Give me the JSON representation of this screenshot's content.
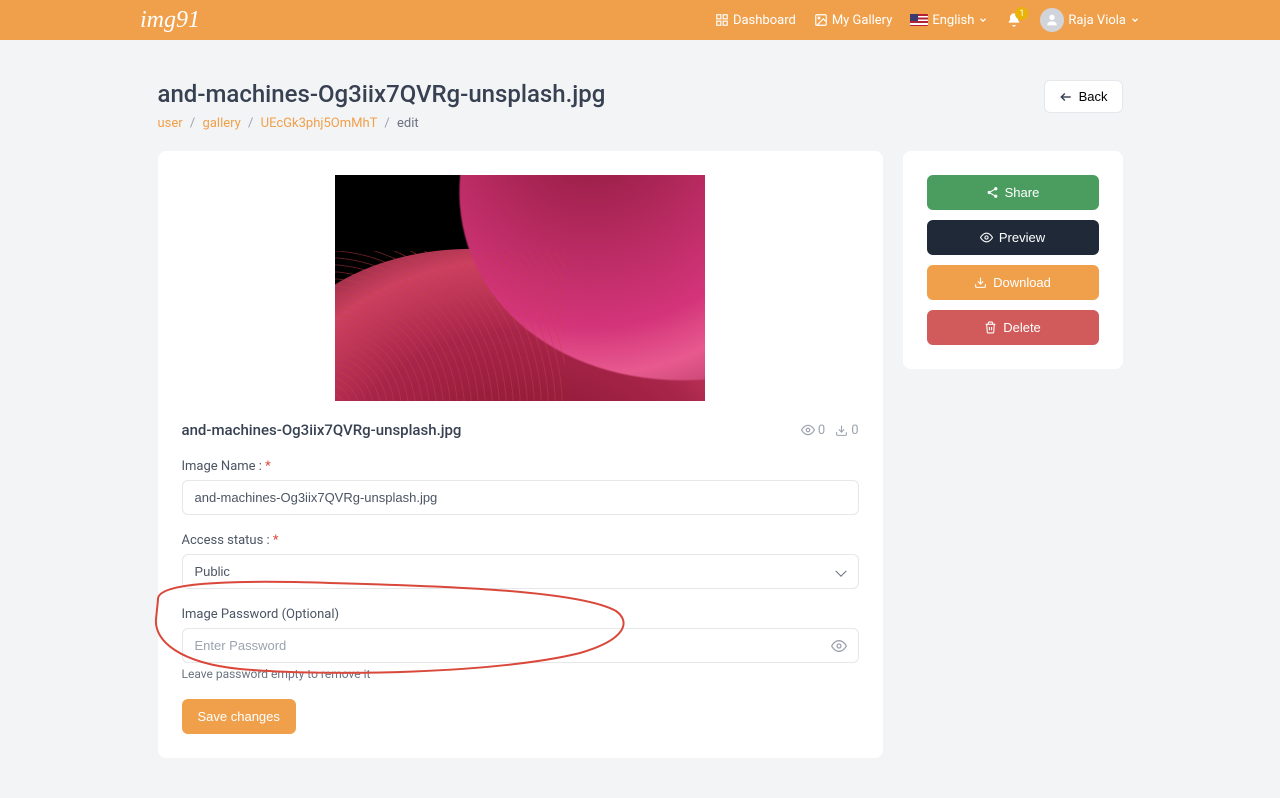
{
  "brand": "img91",
  "nav": {
    "dashboard": "Dashboard",
    "gallery": "My Gallery",
    "language": "English",
    "user": "Raja Viola",
    "notif_count": "1"
  },
  "page": {
    "title": "and-machines-Og3iix7QVRg-unsplash.jpg",
    "back": "Back"
  },
  "breadcrumb": {
    "user": "user",
    "gallery": "gallery",
    "id": "UEcGk3phj5OmMhT",
    "edit": "edit"
  },
  "image": {
    "name": "and-machines-Og3iix7QVRg-unsplash.jpg",
    "views": "0",
    "downloads": "0"
  },
  "form": {
    "name_label": "Image Name :",
    "name_value": "and-machines-Og3iix7QVRg-unsplash.jpg",
    "access_label": "Access status :",
    "access_value": "Public",
    "password_label": "Image Password (Optional)",
    "password_placeholder": "Enter Password",
    "password_hint": "Leave password empty to remove it",
    "save": "Save changes"
  },
  "actions": {
    "share": "Share",
    "preview": "Preview",
    "download": "Download",
    "delete": "Delete"
  }
}
